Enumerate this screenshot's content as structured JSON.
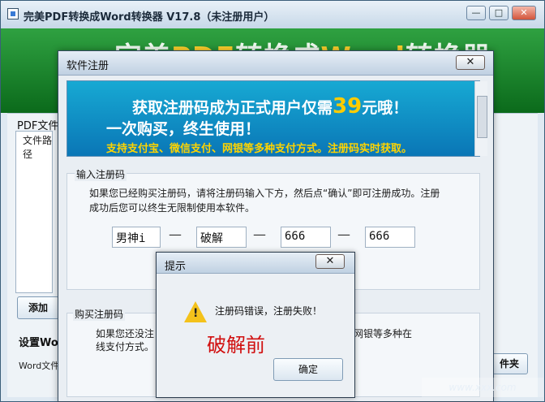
{
  "main_window": {
    "title": "完美PDF转换成Word转换器 V17.8（未注册用户）",
    "controls": {
      "minimize": "—",
      "maximize": "□",
      "close": "✕"
    },
    "banner": {
      "title_part1": "完美",
      "title_pdf": "PDF",
      "title_part2": "转换成",
      "title_word": "Word",
      "title_part3": "转换器"
    },
    "left_labels": {
      "pdf_files": "PDF文件",
      "file_path": "文件路径",
      "add_button": "添加",
      "settings": "设置Wor",
      "word_file": "Word文件"
    },
    "right_button": "件夹"
  },
  "reg_dialog": {
    "title": "软件注册",
    "close_label": "✕",
    "ad": {
      "line1_pre": "获取注册码成为正式用户仅需",
      "price": "39",
      "line1_post": "元哦！",
      "line2": "一次购买，终生使用！",
      "line3": "支持支付宝、微信支付、网银等多种支付方式。注册码实时获取。"
    },
    "input_section": {
      "legend": "输入注册码",
      "note": "如果您已经购买注册码，请将注册码输入下方，然后点“确认”即可注册成功。注册成功后您可以终生无限制使用本软件。",
      "codes": [
        "男神i",
        "破解",
        "666",
        "666"
      ],
      "separator": "—"
    },
    "buy_section": {
      "legend": "购买注册码",
      "note_part1": "如果您还没注",
      "note_part2": "网银等多种在",
      "note_part3": "线支付方式。"
    }
  },
  "prompt_dialog": {
    "title": "提示",
    "close_label": "✕",
    "message": "注册码错误，注册失败！",
    "overlay_text": "破解前",
    "ok_button": "确定",
    "warning_icon_mark": "!"
  },
  "watermark": "www.xxx.com"
}
